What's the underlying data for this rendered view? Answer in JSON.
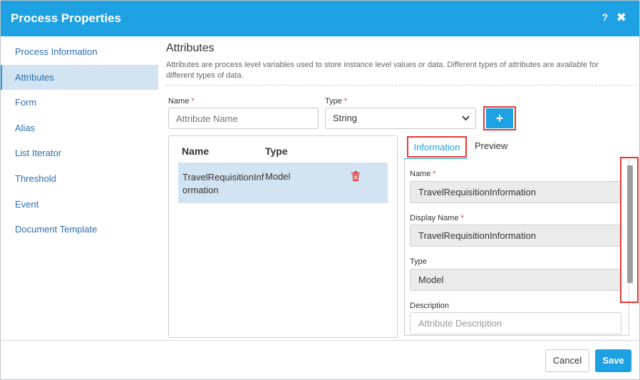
{
  "dialog": {
    "title": "Process Properties",
    "help_label": "?",
    "close_label": "✖"
  },
  "sidebar": {
    "items": [
      {
        "label": "Process Information",
        "active": false
      },
      {
        "label": "Attributes",
        "active": true
      },
      {
        "label": "Form",
        "active": false
      },
      {
        "label": "Alias",
        "active": false
      },
      {
        "label": "List Iterator",
        "active": false
      },
      {
        "label": "Threshold",
        "active": false
      },
      {
        "label": "Event",
        "active": false
      },
      {
        "label": "Document Template",
        "active": false
      }
    ]
  },
  "attributes": {
    "title": "Attributes",
    "description": "Attributes are process level variables used to store instance level values or data. Different types of attributes are available for different types of data.",
    "name_label": "Name",
    "name_placeholder": "Attribute Name",
    "type_label": "Type",
    "type_value": "String",
    "required_mark": "*",
    "add_label": "+"
  },
  "list": {
    "columns": [
      "Name",
      "Type"
    ],
    "rows": [
      {
        "name": "TravelRequisitionInformation",
        "type": "Model"
      }
    ]
  },
  "detail": {
    "tabs": [
      "Information",
      "Preview"
    ],
    "active_tab": "Information",
    "fields": {
      "name_label": "Name",
      "name_value": "TravelRequisitionInformation",
      "display_name_label": "Display Name",
      "display_name_value": "TravelRequisitionInformation",
      "type_label": "Type",
      "type_value": "Model",
      "description_label": "Description",
      "description_placeholder": "Attribute Description"
    }
  },
  "footer": {
    "cancel_label": "Cancel",
    "save_label": "Save"
  },
  "colors": {
    "accent": "#1da1e2",
    "required": "#e53935",
    "highlight": "#d2e3f1"
  }
}
